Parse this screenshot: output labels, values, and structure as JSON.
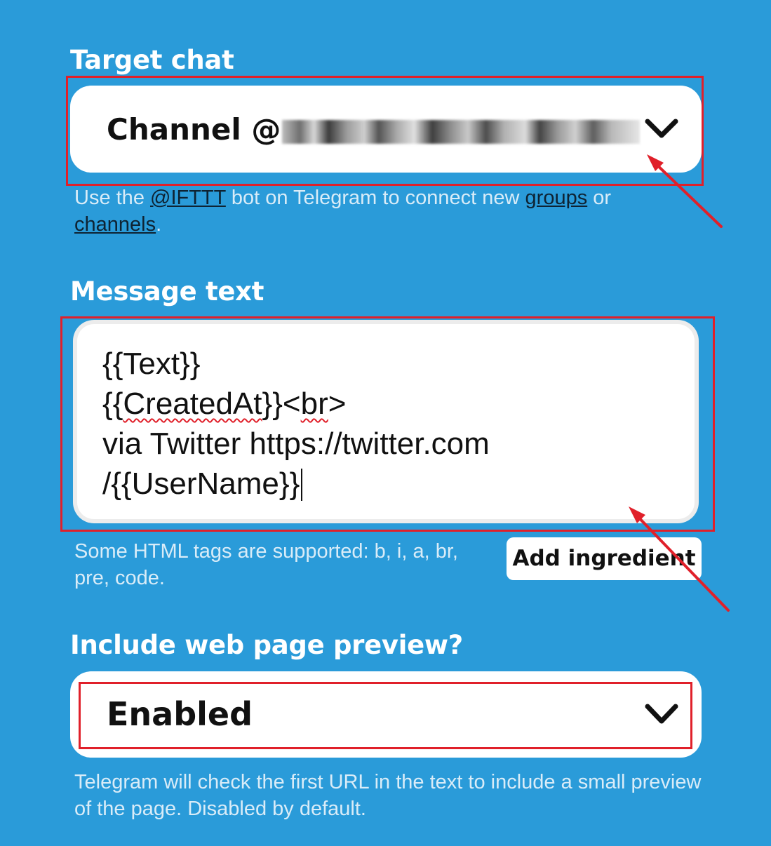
{
  "target_chat": {
    "label": "Target chat",
    "value_prefix": "Channel @",
    "help_parts": [
      "Use the ",
      "@IFTTT",
      " bot on Telegram to connect new ",
      "groups",
      " or ",
      "channels",
      "."
    ]
  },
  "message_text": {
    "label": "Message text",
    "lines": {
      "line1": "{{Text}}",
      "line2_a": "{{",
      "line2_b": "CreatedAt",
      "line2_c": "}}<",
      "line2_d": "br",
      "line2_e": ">",
      "line3": "via Twitter https://twitter.com",
      "line4": "/{{UserName}}"
    },
    "help": "Some HTML tags are supported: b, i, a, br, pre, code.",
    "add_ingredient_label": "Add ingredient"
  },
  "web_preview": {
    "label": "Include web page preview?",
    "value": "Enabled",
    "help": "Telegram will check the first URL in the text to include a small preview of the page. Disabled by default."
  },
  "icons": {
    "dropdown": "chevron-down-icon"
  },
  "colors": {
    "background": "#2a9bd9",
    "annotation_red": "#e0202a",
    "link": "#0e2333"
  }
}
